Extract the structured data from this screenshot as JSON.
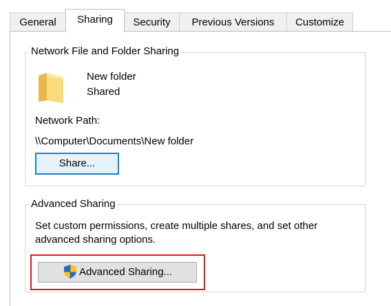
{
  "tabs": [
    {
      "label": "General"
    },
    {
      "label": "Sharing",
      "active": true
    },
    {
      "label": "Security"
    },
    {
      "label": "Previous Versions"
    },
    {
      "label": "Customize"
    }
  ],
  "network_sharing": {
    "title": "Network File and Folder Sharing",
    "folder_name": "New folder",
    "status": "Shared",
    "network_path_label": "Network Path:",
    "network_path": "\\\\Computer\\Documents\\New folder",
    "share_button": "Share..."
  },
  "advanced_sharing": {
    "title": "Advanced Sharing",
    "description_line1": "Set custom permissions, create multiple shares, and set other",
    "description_line2": "advanced sharing options.",
    "button": "Advanced Sharing..."
  },
  "icons": {
    "folder": "folder-icon",
    "shield": "uac-shield-icon"
  },
  "colors": {
    "highlight": "#e0141e",
    "focus_border": "#1a7fd0",
    "folder": "#f5d26b"
  }
}
